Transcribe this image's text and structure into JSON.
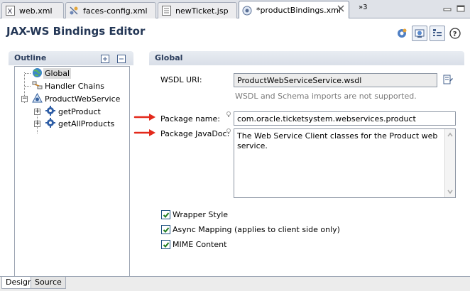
{
  "tabs": [
    {
      "label": "web.xml",
      "icon": "xml-file-icon",
      "active": false
    },
    {
      "label": "faces-config.xml",
      "icon": "faces-config-icon",
      "active": false
    },
    {
      "label": "newTicket.jsp",
      "icon": "jsp-file-icon",
      "active": false
    },
    {
      "label": "*productBindings.xml",
      "icon": "bindings-file-icon",
      "active": true
    }
  ],
  "tab_overflow": "»3",
  "editor": {
    "title": "JAX-WS Bindings Editor",
    "toolbar_icons": [
      "gear-globe-icon",
      "web-service-icon",
      "outline-toggle-icon",
      "help-icon"
    ]
  },
  "outline": {
    "header": "Outline",
    "items": [
      {
        "label": "Global",
        "icon": "globe-icon",
        "selected": true
      },
      {
        "label": "Handler Chains",
        "icon": "handler-chains-icon"
      },
      {
        "label": "ProductWebService",
        "icon": "service-icon"
      },
      {
        "label": "getProduct",
        "icon": "operation-icon"
      },
      {
        "label": "getAllProducts",
        "icon": "operation-icon"
      }
    ]
  },
  "global": {
    "header": "Global",
    "wsdl_label": "WSDL URI:",
    "wsdl_value": "ProductWebServiceService.wsdl",
    "wsdl_hint": "WSDL and Schema imports are not supported.",
    "package_label": "Package name:",
    "package_value": "com.oracle.ticketsystem.webservices.product",
    "javadoc_label": "Package JavaDoc:",
    "javadoc_value": "The Web Service Client classes for the Product web service.",
    "checks": [
      {
        "label": "Wrapper Style",
        "checked": true
      },
      {
        "label": "Async Mapping (applies to client side only)",
        "checked": true
      },
      {
        "label": "MIME Content",
        "checked": true
      }
    ]
  },
  "bottom_tabs": [
    {
      "label": "Design",
      "active": true
    },
    {
      "label": "Source",
      "active": false
    }
  ],
  "colors": {
    "title": "#243756",
    "arrow": "#e3291b",
    "selection": "#dcdcdc"
  }
}
